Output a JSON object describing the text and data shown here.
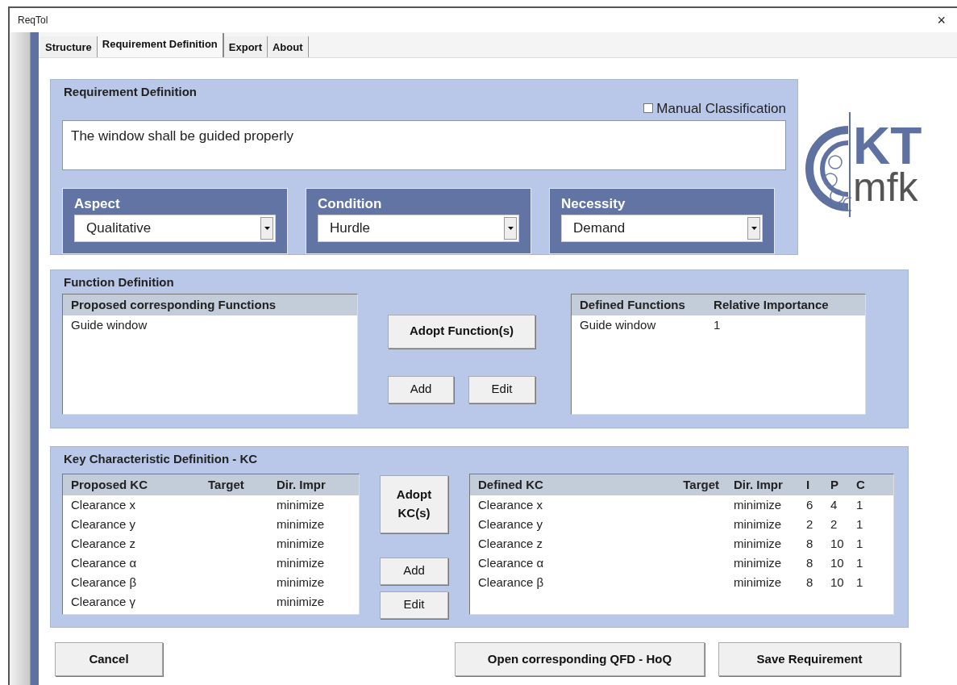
{
  "window": {
    "title": "ReqTol",
    "close": "×"
  },
  "tabs": [
    {
      "label": "Structure",
      "selected": false
    },
    {
      "label": "Requirement Definition",
      "selected": true
    },
    {
      "label": "Export",
      "selected": false
    },
    {
      "label": "About",
      "selected": false
    }
  ],
  "requirement": {
    "title": "Requirement Definition",
    "manual_classification": {
      "label": "Manual Classification",
      "checked": false
    },
    "text": "The window shall be guided properly",
    "dropdowns": [
      {
        "label": "Aspect",
        "value": "Qualitative"
      },
      {
        "label": "Condition",
        "value": "Hurdle"
      },
      {
        "label": "Necessity",
        "value": "Demand"
      }
    ]
  },
  "logo": {
    "line_1": "KT",
    "line_2": "mfk"
  },
  "function_definition": {
    "title": "Function Definition",
    "proposed": {
      "columns": [
        "Proposed corresponding Functions"
      ],
      "rows": [
        [
          "Guide window"
        ]
      ]
    },
    "adopt_button": "Adopt Function(s)",
    "add_button": "Add",
    "edit_button": "Edit",
    "defined": {
      "columns": [
        "Defined Functions",
        "Relative Importance"
      ],
      "rows": [
        [
          "Guide window",
          "1"
        ]
      ]
    }
  },
  "kc_definition": {
    "title": "Key Characteristic Definition - KC",
    "proposed": {
      "columns": [
        "Proposed KC",
        "Target",
        "Dir. Impr"
      ],
      "rows": [
        [
          "Clearance x",
          "",
          "minimize"
        ],
        [
          "Clearance y",
          "",
          "minimize"
        ],
        [
          "Clearance z",
          "",
          "minimize"
        ],
        [
          "Clearance α",
          "",
          "minimize"
        ],
        [
          "Clearance β",
          "",
          "minimize"
        ],
        [
          "Clearance γ",
          "",
          "minimize"
        ]
      ]
    },
    "adopt_button": "Adopt KC(s)",
    "add_button": "Add",
    "edit_button": "Edit",
    "defined": {
      "columns": [
        "Defined KC",
        "Target",
        "Dir. Impr",
        "I",
        "P",
        "C"
      ],
      "rows": [
        [
          "Clearance x",
          "",
          "minimize",
          "6",
          "4",
          "1"
        ],
        [
          "Clearance y",
          "",
          "minimize",
          "2",
          "2",
          "1"
        ],
        [
          "Clearance z",
          "",
          "minimize",
          "8",
          "10",
          "1"
        ],
        [
          "Clearance α",
          "",
          "minimize",
          "8",
          "10",
          "1"
        ],
        [
          "Clearance β",
          "",
          "minimize",
          "8",
          "10",
          "1"
        ]
      ]
    }
  },
  "buttons": [
    {
      "label": "Cancel"
    },
    {
      "label": "Open corresponding QFD - HoQ"
    },
    {
      "label": "Save Requirement"
    }
  ]
}
